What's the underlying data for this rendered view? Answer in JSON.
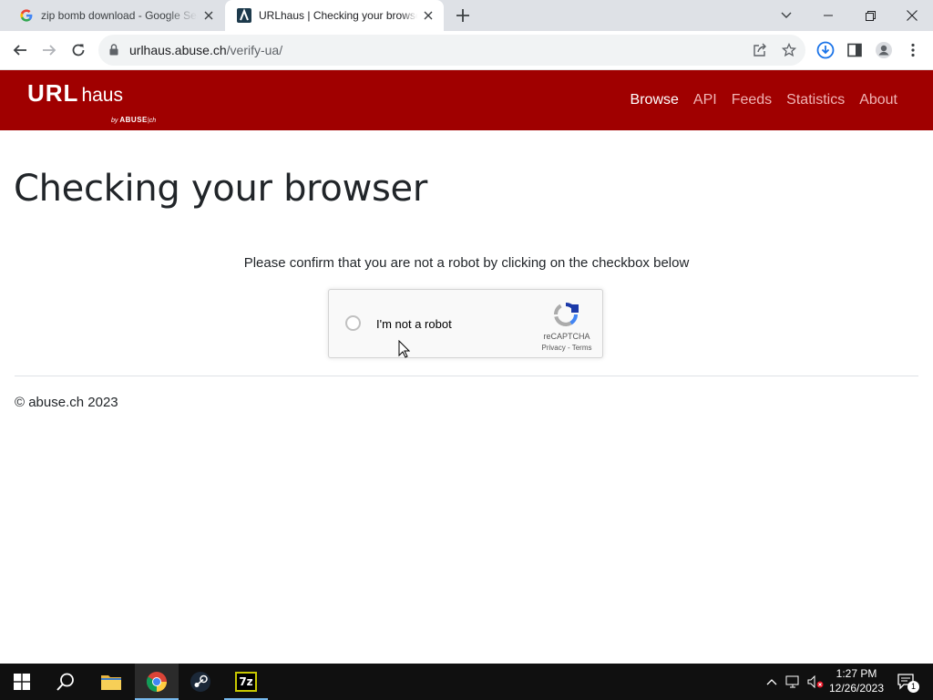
{
  "browser": {
    "tabs": [
      {
        "title": "zip bomb download - Google Search",
        "active": false
      },
      {
        "title": "URLhaus | Checking your browser",
        "active": true
      }
    ],
    "address": {
      "host": "urlhaus.abuse.ch",
      "path": "/verify-ua/"
    }
  },
  "site": {
    "logo": {
      "primary": "URL",
      "secondary": "haus",
      "by": "by",
      "brand": "ABUSE",
      "suffix": "ch"
    },
    "nav": [
      "Browse",
      "API",
      "Feeds",
      "Statistics",
      "About"
    ],
    "active_nav": "Browse",
    "brand_color": "#a00000"
  },
  "page": {
    "title": "Checking your browser",
    "instruction": "Please confirm that you are not a robot by clicking on the checkbox below",
    "captcha": {
      "label": "I'm not a robot",
      "brand": "reCAPTCHA",
      "privacy": "Privacy",
      "separator": " - ",
      "terms": "Terms"
    },
    "footer": "© abuse.ch 2023"
  },
  "taskbar": {
    "time": "1:27 PM",
    "date": "12/26/2023",
    "notification_count": "1",
    "sevenzip_label": "7z"
  }
}
